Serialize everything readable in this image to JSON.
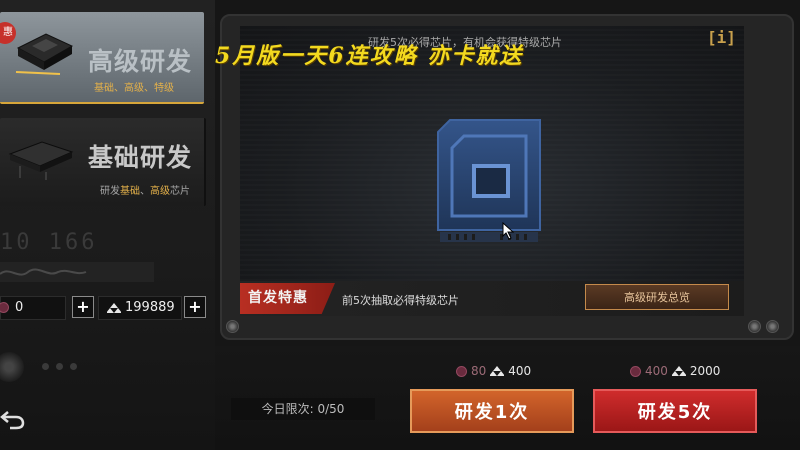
{
  "left_menu": {
    "advanced": {
      "badge": "惠",
      "title": "高级研发",
      "subtitle": "基础、高级、特级"
    },
    "basic": {
      "title": "基础研发",
      "subtitle_prefix": "研发",
      "subtitle_hl1": "基础",
      "subtitle_sep": "、",
      "subtitle_hl2": "高级",
      "subtitle_suffix": "芯片"
    },
    "id_watermark": "10 166",
    "currency": {
      "gems": "0",
      "coins": "199889"
    }
  },
  "main": {
    "info_text": "研发5次必得芯片，有机会获得特级芯片",
    "info_button": "[i]",
    "overlay_caption": "5月版一天6连攻略 亦卡就送",
    "promo": {
      "badge": "首发特惠",
      "text": "前5次抽取必得特级芯片",
      "overview_button": "高级研发总览"
    }
  },
  "actions": {
    "daily_limit": "今日限次: 0/50",
    "draw_one": {
      "label": "研发1次",
      "cost_gem": "80",
      "cost_coin": "400"
    },
    "draw_five": {
      "label": "研发5次",
      "cost_gem": "400",
      "cost_coin": "2000"
    }
  },
  "icons": {
    "chip": "chip-icon",
    "back": "back-arrow-icon",
    "plus": "plus-icon",
    "gem": "gem-icon",
    "coin": "coin-pile-icon"
  },
  "colors": {
    "accent_gold": "#e3b04a",
    "draw_one_orange": "#c4542a",
    "draw_five_red": "#c42424",
    "chip_blue": "#2c4a7a"
  }
}
